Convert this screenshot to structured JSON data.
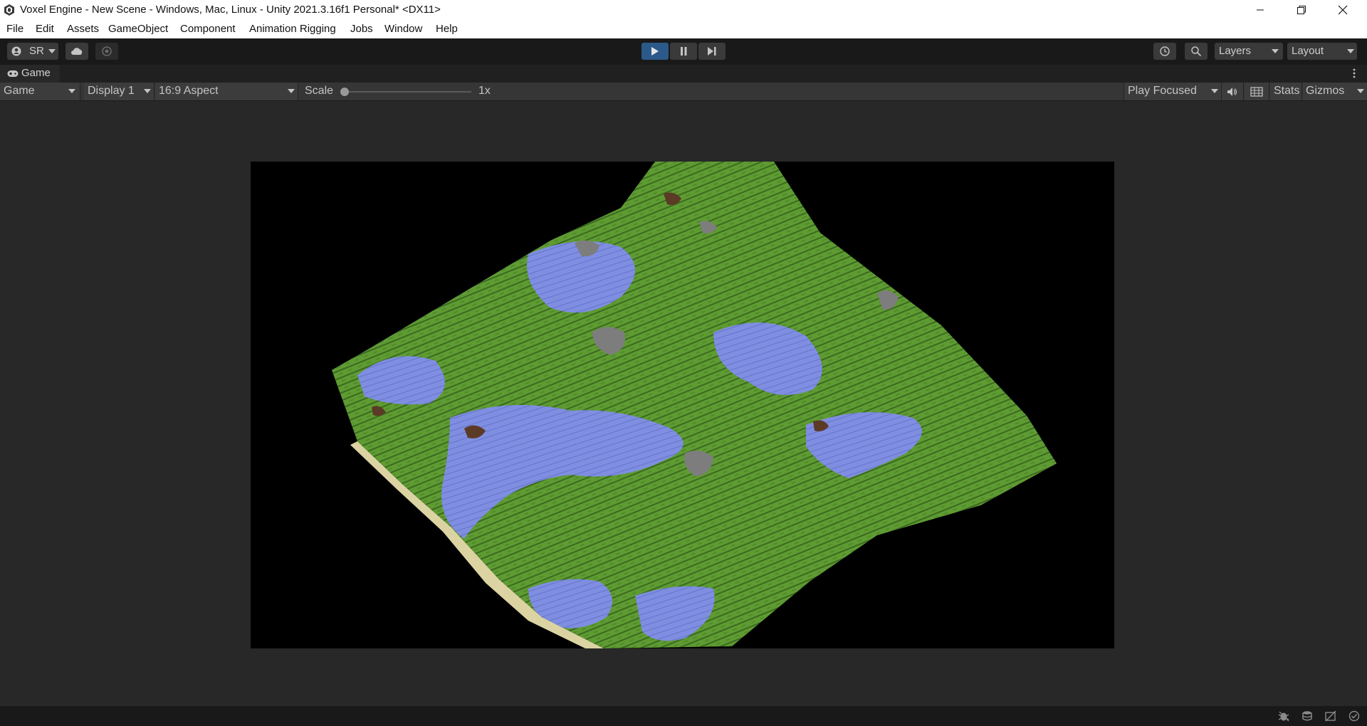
{
  "window": {
    "title": "Voxel Engine - New Scene - Windows, Mac, Linux - Unity 2021.3.16f1 Personal* <DX11>"
  },
  "menu": [
    "File",
    "Edit",
    "Assets",
    "GameObject",
    "Component",
    "Animation Rigging",
    "Jobs",
    "Window",
    "Help"
  ],
  "toolbar": {
    "account_label": "SR",
    "layers_label": "Layers",
    "layout_label": "Layout"
  },
  "tab": {
    "label": "Game"
  },
  "game_toolbar": {
    "view_mode": "Game",
    "display": "Display 1",
    "aspect": "16:9 Aspect",
    "scale_label": "Scale",
    "scale_value": "1x",
    "scale_fraction": 0.0,
    "play_mode": "Play Focused",
    "stats_label": "Stats",
    "gizmos_label": "Gizmos"
  },
  "colors": {
    "accent_play": "#2b5a8a",
    "grass": "#5e9b32",
    "water": "#7f8ee0",
    "deep_water": "#2f45c8",
    "sand": "#dcd3a3",
    "stone": "#7d7d7d",
    "dirt": "#5b3a26"
  }
}
